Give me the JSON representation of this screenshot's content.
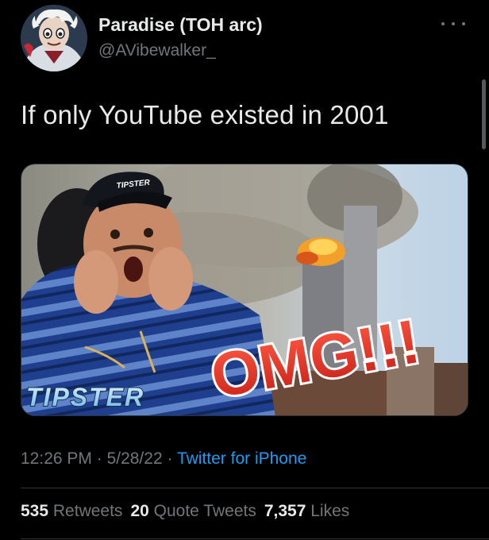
{
  "author": {
    "display_name": "Paradise (TOH arc)",
    "handle": "@AVibewalker_",
    "avatar_icon": "cartoon-character-avatar"
  },
  "tweet": {
    "text": "If only YouTube existed in 2001",
    "media": {
      "overlay_title": "OMG!!!",
      "overlay_brand": "TIPSTER",
      "cap_text": "TIPSTER"
    }
  },
  "meta": {
    "time": "12:26 PM",
    "separator": " · ",
    "date": "5/28/22",
    "source": "Twitter for iPhone"
  },
  "stats": {
    "retweets_count": "535",
    "retweets_label": "Retweets",
    "quotes_count": "20",
    "quotes_label": "Quote Tweets",
    "likes_count": "7,357",
    "likes_label": "Likes"
  },
  "colors": {
    "background": "#000000",
    "primary_text": "#e7e9ea",
    "secondary_text": "#71767b",
    "link": "#1d9bf0",
    "divider": "#2f3336",
    "omg_red": "#e0352b"
  }
}
